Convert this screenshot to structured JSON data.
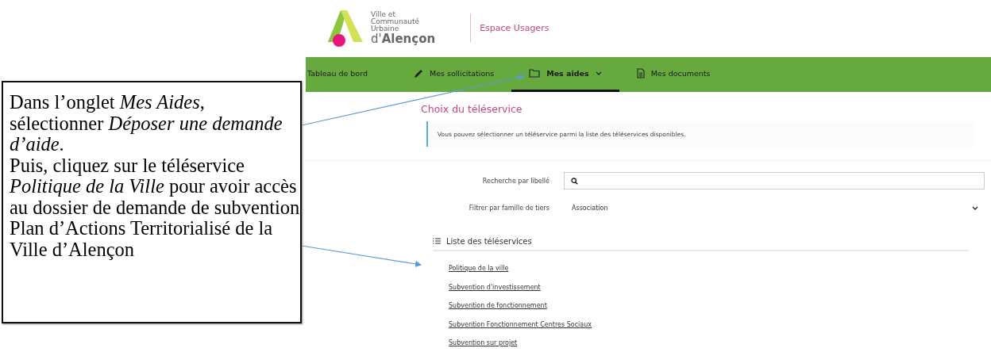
{
  "callout": {
    "paragraphs": [
      "Dans l’onglet *Mes Aides*, sélectionner *Déposer une demande d’aide*.",
      "Puis, cliquez sur le téléservice *Politique de la Ville* pour avoir accès au dossier de demande de subvention Plan d’Actions Territorialisé de la Ville d’Alençon"
    ]
  },
  "header": {
    "logo_lines": [
      "Ville et",
      "Communauté",
      "Urbaine",
      "d'**Alençon**"
    ],
    "portal": "Espace Usagers"
  },
  "nav": {
    "items": [
      {
        "label": "Tableau de bord",
        "selected": false
      },
      {
        "label": "Mes sollicitations",
        "selected": false
      },
      {
        "label": "Mes aides",
        "selected": true
      },
      {
        "label": "Mes documents",
        "selected": false
      }
    ]
  },
  "page": {
    "title": "Choix du téléservice",
    "info": "Vous pouvez sélectionner un téléservice parmi la liste des téléservices disponibles.",
    "search": {
      "label": "Recherche par libellé"
    },
    "filter": {
      "label": "Filtrer par famille de tiers",
      "value": "Association"
    },
    "list": {
      "title": "Liste des téléservices",
      "items": [
        "Politique de la ville",
        "Subvention d'investissement",
        "Subvention de fonctionnement",
        "Subvention Fonctionnement Centres Sociaux",
        "Subvention sur projet"
      ]
    }
  }
}
